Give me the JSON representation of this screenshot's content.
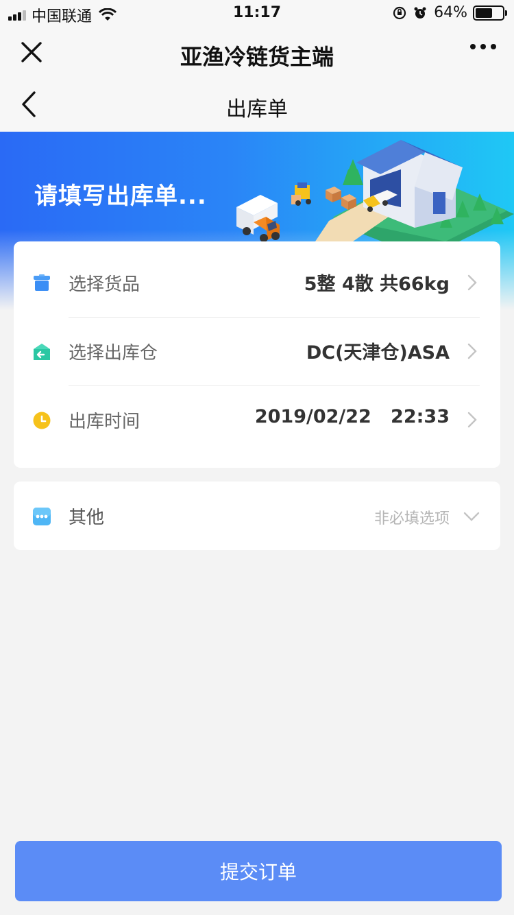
{
  "status_bar": {
    "carrier": "中国联通",
    "time": "11:17",
    "battery_percent": "64%",
    "battery_level": 0.64
  },
  "app_bar": {
    "title": "亚渔冷链货主端",
    "close_icon": "close-icon",
    "more_icon": "more-icon"
  },
  "page_nav": {
    "title": "出库单",
    "back_icon": "chevron-left-icon"
  },
  "banner": {
    "text": "请填写出库单..."
  },
  "form": {
    "rows": [
      {
        "label": "选择货品",
        "value": "5整 4散 共66kg",
        "icon": "package-icon",
        "icon_color": "#3b8ef5"
      },
      {
        "label": "选择出库仓",
        "value": "DC(天津仓)ASA",
        "icon": "warehouse-out-icon",
        "icon_color": "#27c3a8"
      },
      {
        "label": "出库时间",
        "value": "2019/02/22   22:33",
        "icon": "clock-icon",
        "icon_color": "#f6c21b"
      }
    ]
  },
  "other": {
    "label": "其他",
    "hint": "非必填选项",
    "icon": "more-dots-icon",
    "icon_color": "#4fb6f5"
  },
  "submit": {
    "label": "提交订单",
    "color": "#5b8cf6"
  }
}
